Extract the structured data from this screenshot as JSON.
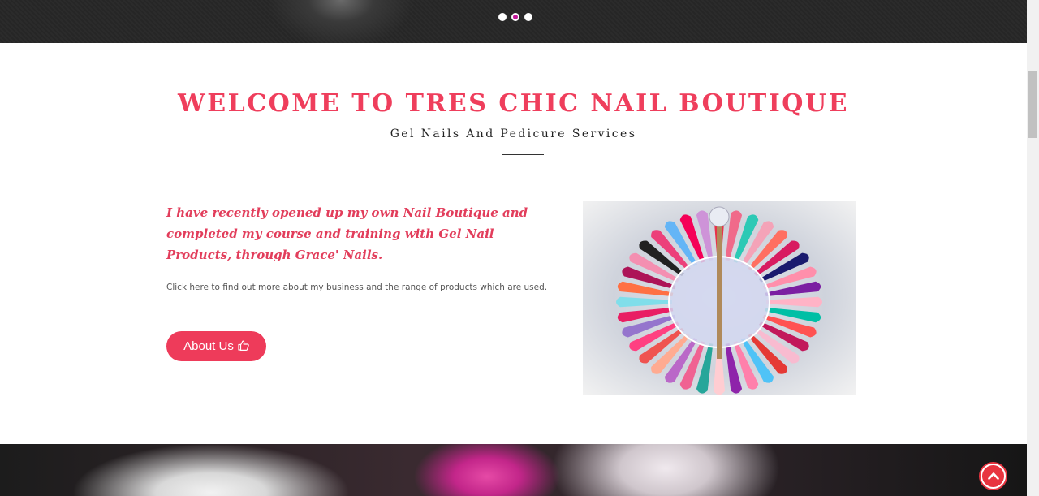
{
  "slider": {
    "dots": 3,
    "active_index": 1
  },
  "welcome": {
    "title": "WELCOME TO TRES CHIC NAIL BOUTIQUE",
    "subtitle": "Gel Nails And Pedicure Services"
  },
  "intro": {
    "lead": "I have recently opened up my own Nail Boutique and completed my course and training with Gel Nail Products, through Grace' Nails.",
    "details": "Click here to find out more about my business and the range of products which are used.",
    "button_label": "About Us",
    "button_icon": "thumbs-up-icon"
  },
  "image": {
    "subject": "nail-polish-color-wheel"
  },
  "back_to_top": {
    "icon": "chevron-up-icon"
  },
  "colors": {
    "accent": "#ef3e5c",
    "button": "#ee3b5a",
    "active_dot": "#c2189a",
    "back_to_top": "#e8343f"
  }
}
